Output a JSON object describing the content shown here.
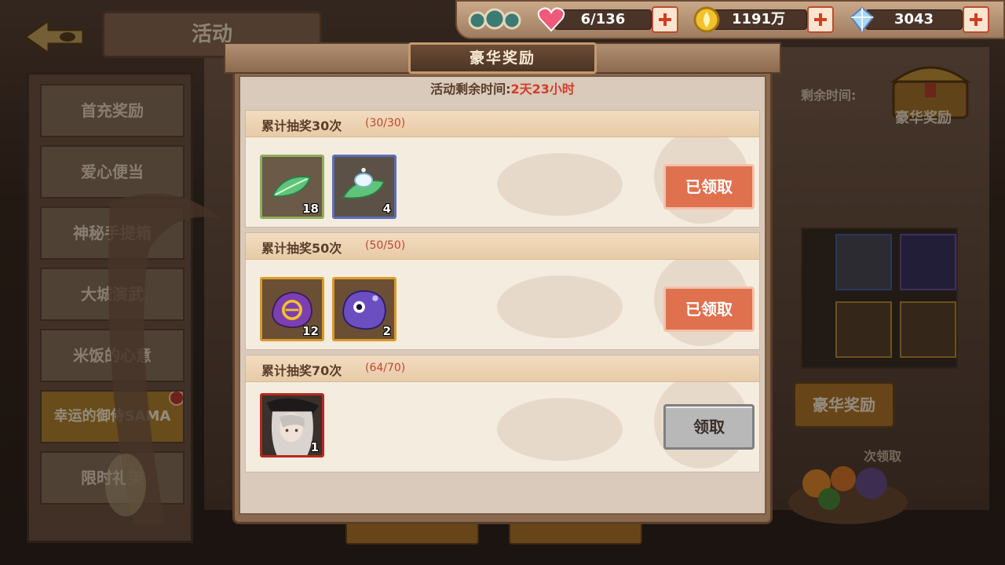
{
  "background": {
    "screen_title": "活动",
    "side_menu": [
      {
        "label": "首充奖励",
        "active": false
      },
      {
        "label": "爱心便当",
        "active": false
      },
      {
        "label": "神秘手提箱",
        "active": false
      },
      {
        "label": "大城演武",
        "active": false
      },
      {
        "label": "米饭的心意",
        "active": false
      },
      {
        "label": "幸运的御侍SAMA",
        "active": true,
        "badge": true
      },
      {
        "label": "限时礼架",
        "active": false
      }
    ],
    "right_panel": {
      "time_label": "剩余时间:",
      "chest_label": "豪华奖励",
      "luxury_button": "豪华奖励",
      "note": "次领取"
    }
  },
  "status_bar": {
    "stamina": "6/136",
    "gold": "1191万",
    "crystals": "3043"
  },
  "modal": {
    "title": "豪华奖励",
    "timer_prefix": "活动剩余时间:",
    "timer_value": "2天23小时",
    "rows": [
      {
        "title": "累计抽奖30次",
        "progress": "(30/30)",
        "button": "已领取",
        "button_state": "claimed",
        "items": [
          {
            "icon": "green-leaf-icon",
            "count": "18",
            "frame": "green"
          },
          {
            "icon": "glowing-leaf-icon",
            "count": "4",
            "frame": "blue"
          }
        ]
      },
      {
        "title": "累计抽奖50次",
        "progress": "(50/50)",
        "button": "已领取",
        "button_state": "claimed",
        "items": [
          {
            "icon": "purple-slime-rune-icon",
            "count": "12",
            "frame": "gold"
          },
          {
            "icon": "purple-slime-eye-icon",
            "count": "2",
            "frame": "gold"
          }
        ]
      },
      {
        "title": "累计抽奖70次",
        "progress": "(64/70)",
        "button": "领取",
        "button_state": "available",
        "items": [
          {
            "icon": "character-portrait-icon",
            "count": "1",
            "frame": "red"
          }
        ]
      }
    ]
  },
  "colors": {
    "accent_red": "#d23d2b",
    "claimed_button": "#e0714f",
    "available_button": "#b8b8b8"
  }
}
